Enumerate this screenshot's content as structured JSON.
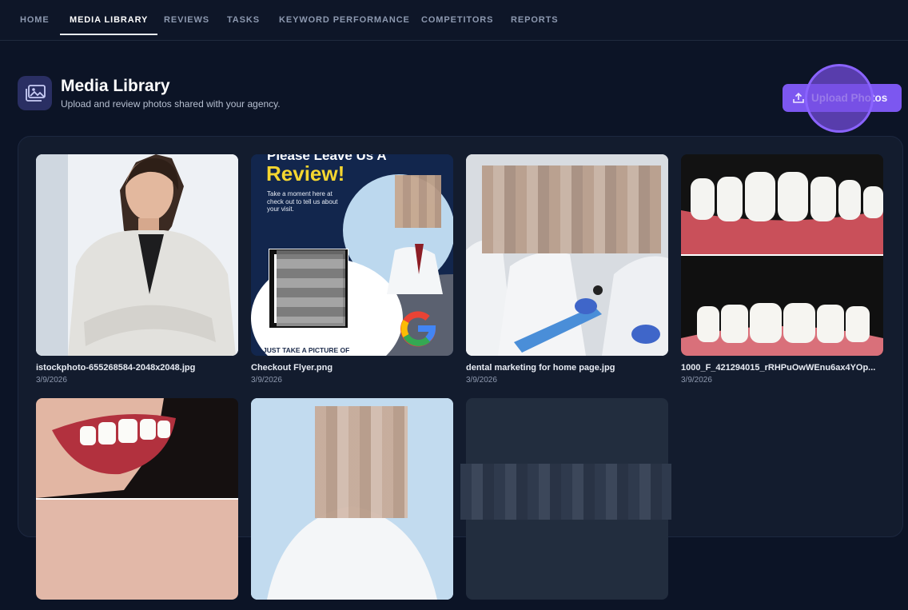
{
  "nav": {
    "tabs": [
      {
        "label": "HOME"
      },
      {
        "label": "MEDIA LIBRARY",
        "active": true
      },
      {
        "label": "REVIEWS"
      },
      {
        "label": "TASKS"
      },
      {
        "label": "KEYWORD PERFORMANCE"
      },
      {
        "label": "COMPETITORS"
      },
      {
        "label": "REPORTS"
      }
    ]
  },
  "header": {
    "icon": "image-gallery-icon",
    "title": "Media Library",
    "subtitle": "Upload and review photos shared with your agency.",
    "upload_label": "Upload Photos",
    "upload_icon": "upload-icon"
  },
  "media": [
    {
      "filename": "istockphoto-655268584-2048x2048.jpg",
      "date": "3/9/2026"
    },
    {
      "filename": "Checkout Flyer.png",
      "date": "3/9/2026",
      "flyer_heading": "Please Leave Us A",
      "flyer_title": "Review!",
      "flyer_body": "Take a moment here at check out to tell us about your visit.",
      "flyer_footer": "JUST TAKE A PICTURE OF"
    },
    {
      "filename": "dental marketing for home page.jpg",
      "date": "3/9/2026"
    },
    {
      "filename": "1000_F_421294015_rRHPuOwWEnu6ax4YOp...",
      "date": "3/9/2026"
    },
    {
      "filename": "",
      "date": ""
    },
    {
      "filename": "",
      "date": ""
    },
    {
      "filename": "",
      "date": ""
    }
  ],
  "colors": {
    "background": "#0c1426",
    "accent": "#7c57f0",
    "panel": "#131c2e"
  }
}
